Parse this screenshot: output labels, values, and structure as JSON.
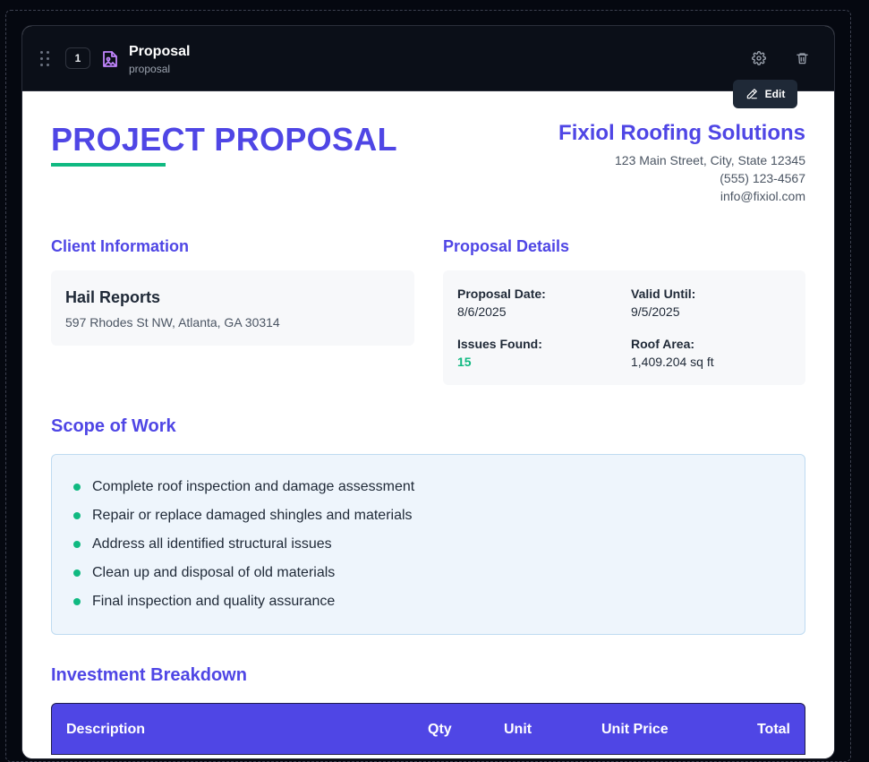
{
  "header": {
    "index": "1",
    "title": "Proposal",
    "subtitle": "proposal",
    "icons": {
      "drag": "drag-handle-icon",
      "file": "file-image-icon",
      "settings": "gear-icon",
      "delete": "trash-icon"
    }
  },
  "edit_button": {
    "label": "Edit",
    "icon": "pencil-icon"
  },
  "document": {
    "title": "PROJECT PROPOSAL",
    "company": {
      "name": "Fixiol Roofing Solutions",
      "address": "123 Main Street, City, State 12345",
      "phone": "(555) 123-4567",
      "email": "info@fixiol.com"
    },
    "client_section": {
      "heading": "Client Information",
      "name": "Hail Reports",
      "address": "597 Rhodes St NW, Atlanta, GA 30314"
    },
    "details_section": {
      "heading": "Proposal Details",
      "proposal_date_label": "Proposal Date:",
      "proposal_date": "8/6/2025",
      "valid_until_label": "Valid Until:",
      "valid_until": "9/5/2025",
      "issues_label": "Issues Found:",
      "issues": "15",
      "roof_area_label": "Roof Area:",
      "roof_area": "1,409.204 sq ft"
    },
    "scope": {
      "heading": "Scope of Work",
      "items": [
        "Complete roof inspection and damage assessment",
        "Repair or replace damaged shingles and materials",
        "Address all identified structural issues",
        "Clean up and disposal of old materials",
        "Final inspection and quality assurance"
      ]
    },
    "investment": {
      "heading": "Investment Breakdown",
      "columns": [
        "Description",
        "Qty",
        "Unit",
        "Unit Price",
        "Total"
      ]
    }
  },
  "colors": {
    "accent": "#4f46e5",
    "green": "#10b981",
    "header_bg": "#0b0f18"
  }
}
